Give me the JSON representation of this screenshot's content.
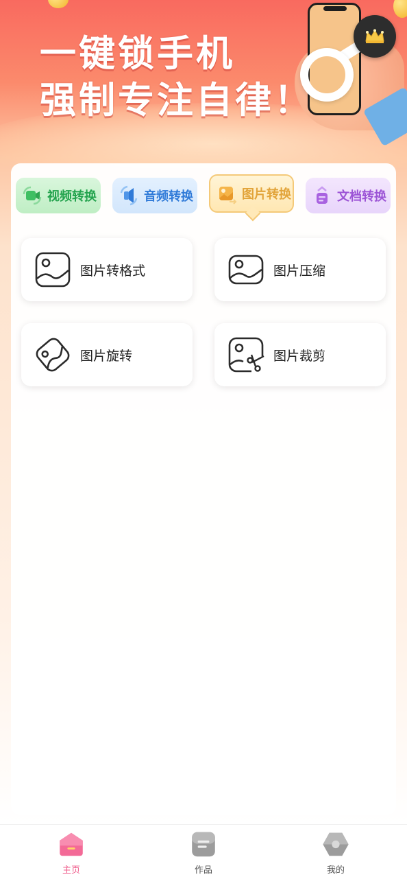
{
  "banner": {
    "headline_line1": "一键锁手机",
    "headline_line2": "强制专注自律！",
    "vip_icon": "crown-icon"
  },
  "category_tabs": [
    {
      "label": "视频转换",
      "icon": "video-convert-icon",
      "color": "#23a34d",
      "selected": false
    },
    {
      "label": "音频转换",
      "icon": "audio-convert-icon",
      "color": "#2f7ad8",
      "selected": false
    },
    {
      "label": "图片转换",
      "icon": "image-convert-icon",
      "color": "#e2a43a",
      "selected": true
    },
    {
      "label": "文档转换",
      "icon": "document-convert-icon",
      "color": "#9c54d6",
      "selected": false
    }
  ],
  "tools": [
    {
      "label": "图片转格式",
      "icon": "image-icon"
    },
    {
      "label": "图片压缩",
      "icon": "image-icon"
    },
    {
      "label": "图片旋转",
      "icon": "rotated-image-icon"
    },
    {
      "label": "图片裁剪",
      "icon": "image-crop-icon"
    }
  ],
  "tabbar": [
    {
      "label": "主页",
      "icon": "home-icon",
      "active": true
    },
    {
      "label": "作品",
      "icon": "works-icon",
      "active": false
    },
    {
      "label": "我的",
      "icon": "profile-icon",
      "active": false
    }
  ],
  "colors": {
    "accent": "#ef5b8a",
    "banner_top": "#f96a5f",
    "selected_tab_border": "#f4c978"
  }
}
